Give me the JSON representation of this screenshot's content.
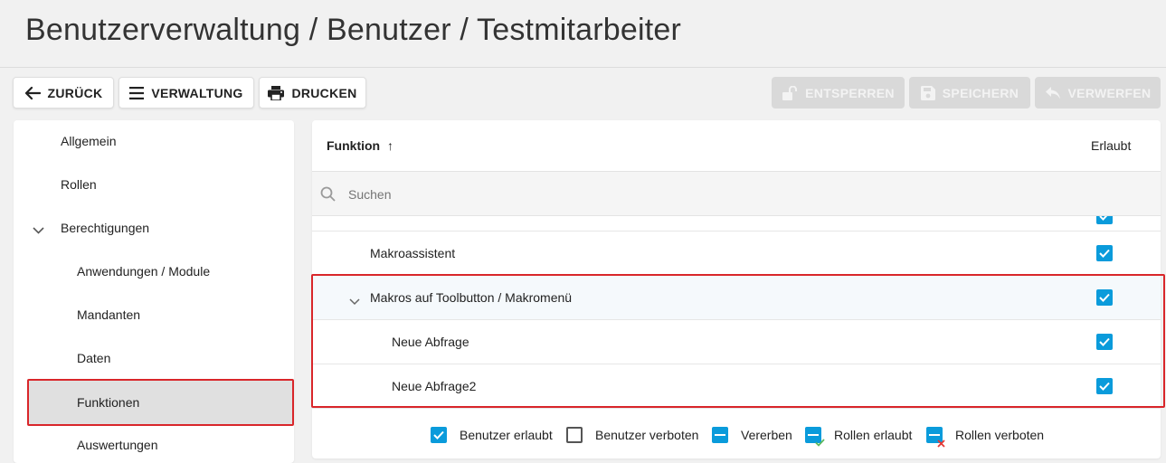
{
  "breadcrumb": "Benutzerverwaltung / Benutzer / Testmitarbeiter",
  "toolbar": {
    "back_label": "ZURÜCK",
    "admin_label": "VERWALTUNG",
    "print_label": "DRUCKEN",
    "unlock_label": "ENTSPERREN",
    "save_label": "SPEICHERN",
    "discard_label": "VERWERFEN"
  },
  "sidebar": {
    "items": [
      {
        "label": "Allgemein"
      },
      {
        "label": "Rollen"
      },
      {
        "label": "Berechtigungen"
      },
      {
        "label": "Anwendungen / Module"
      },
      {
        "label": "Mandanten"
      },
      {
        "label": "Daten"
      },
      {
        "label": "Funktionen"
      },
      {
        "label": "Auswertungen"
      }
    ],
    "selected": "Funktionen"
  },
  "table": {
    "col_function": "Funktion",
    "sort_indicator": "↑",
    "col_allowed": "Erlaubt",
    "search_placeholder": "Suchen",
    "rows": [
      {
        "label": "Makroassistent",
        "allowed": true
      },
      {
        "label": "Makros auf Toolbutton / Makromenü",
        "allowed": true,
        "expanded": true
      },
      {
        "label": "Neue Abfrage",
        "allowed": true
      },
      {
        "label": "Neue Abfrage2",
        "allowed": true
      }
    ]
  },
  "legend": {
    "user_allowed": "Benutzer erlaubt",
    "user_denied": "Benutzer verboten",
    "inherit": "Vererben",
    "roles_allowed": "Rollen erlaubt",
    "roles_denied": "Rollen verboten"
  },
  "colors": {
    "accent": "#0a9bdb",
    "highlight_border": "#d9262a"
  }
}
